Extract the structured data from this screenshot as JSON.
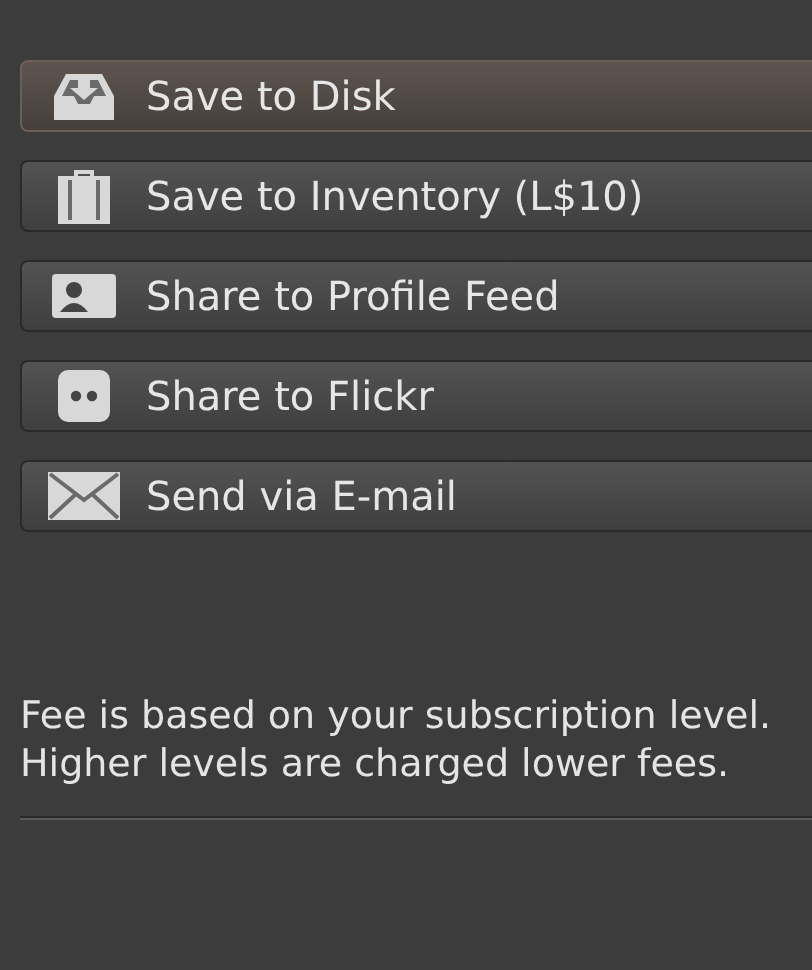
{
  "actions": [
    {
      "kind": "disk",
      "label": "Save to Disk",
      "selected": true
    },
    {
      "kind": "inventory",
      "label": "Save to Inventory (L$10)",
      "selected": false
    },
    {
      "kind": "profile",
      "label": "Share to Profile Feed",
      "selected": false
    },
    {
      "kind": "flickr",
      "label": "Share to Flickr",
      "selected": false
    },
    {
      "kind": "email",
      "label": "Send via E-mail",
      "selected": false
    }
  ],
  "note": "Fee is based on your subscription level. Higher levels are charged lower fees."
}
